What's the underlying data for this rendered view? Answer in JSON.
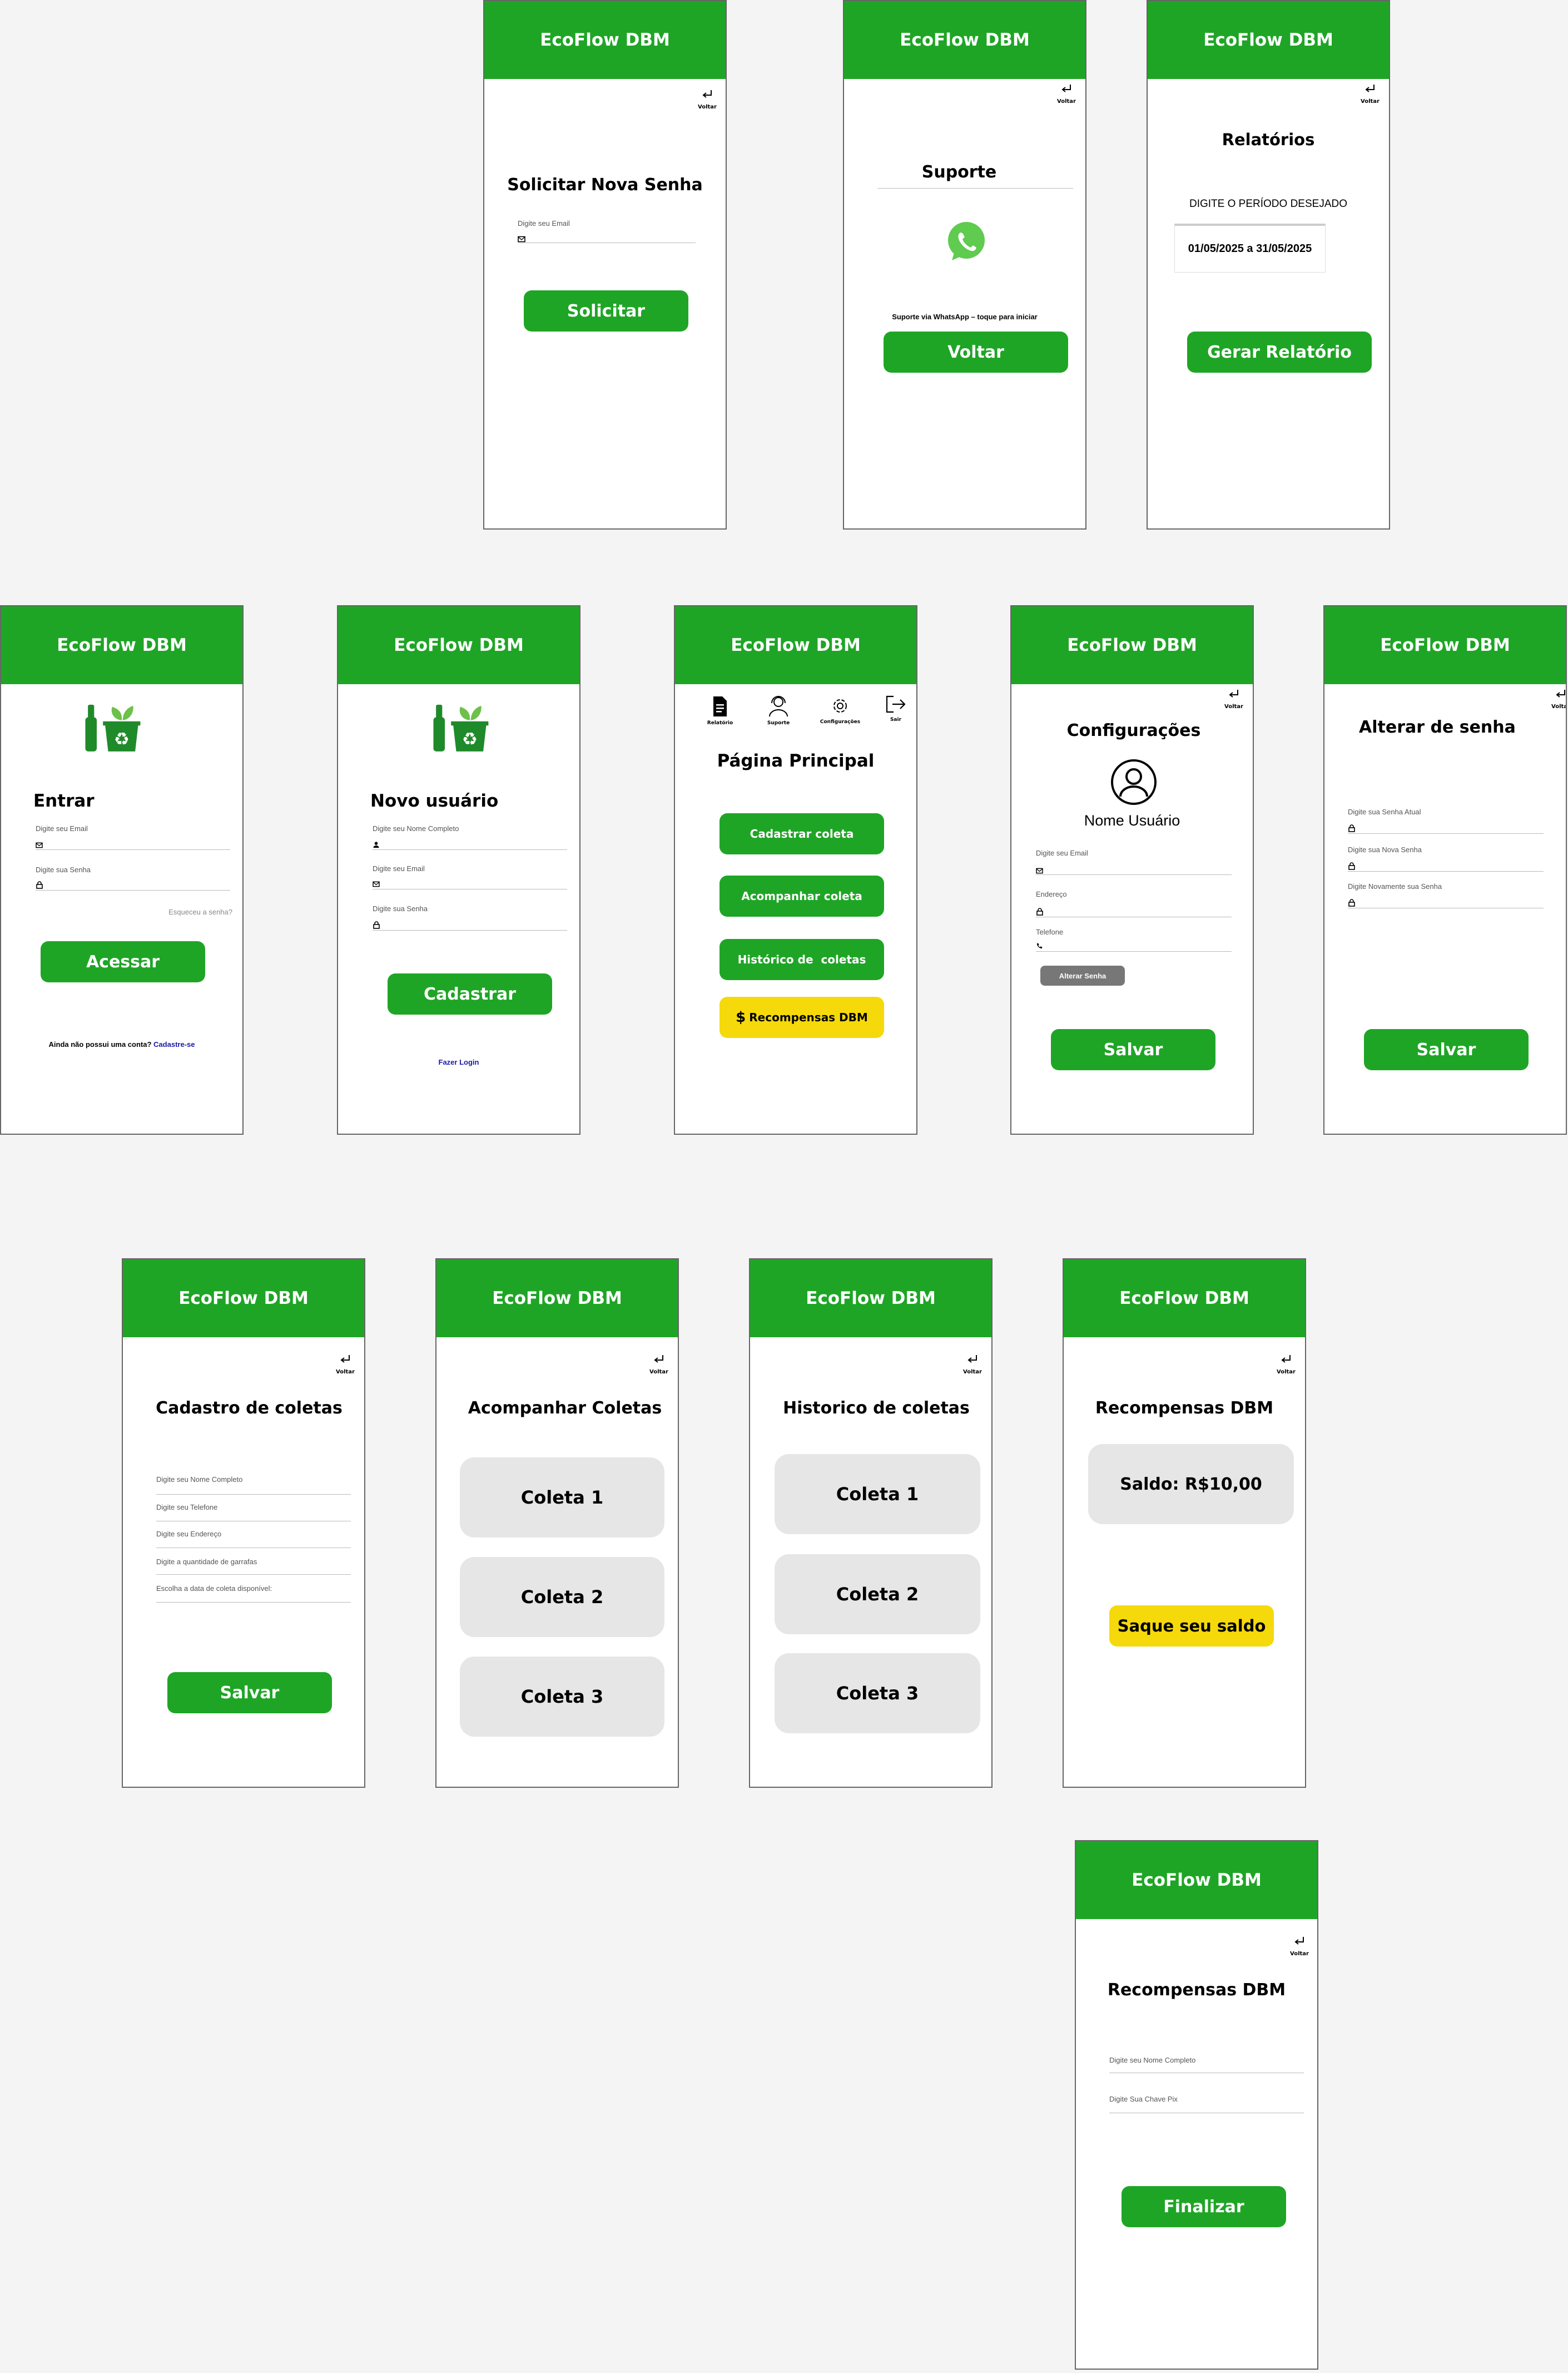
{
  "app_name": "EcoFlow DBM",
  "voltar": "Voltar",
  "colors": {
    "brand_green": "#1fa526",
    "accent_yellow": "#f5d90b",
    "gray_button": "#777777",
    "link_blue": "#1a1aa8"
  },
  "solicitar": {
    "title": "Solicitar Nova Senha",
    "email_label": "Digite seu Email",
    "button": "Solicitar"
  },
  "suporte": {
    "title": "Suporte",
    "caption": "Suporte via WhatsApp – toque para iniciar",
    "button": "Voltar",
    "icon": "whatsapp-icon"
  },
  "relatorios": {
    "title": "Relatórios",
    "prompt": "DIGITE O PERÍODO DESEJADO",
    "period": "01/05/2025 a 31/05/2025",
    "button": "Gerar Relatório"
  },
  "login": {
    "title": "Entrar",
    "email_label": "Digite seu Email",
    "password_label": "Digite sua Senha",
    "forgot": "Esqueceu a senha?",
    "button": "Acessar",
    "no_account": "Ainda não possui uma conta?",
    "signup_link": "Cadastre-se"
  },
  "novo": {
    "title": "Novo usuário",
    "name_label": "Digite seu Nome Completo",
    "email_label": "Digite seu Email",
    "password_label": "Digite sua Senha",
    "button": "Cadastrar",
    "login_link": "Fazer Login"
  },
  "principal": {
    "nav": [
      "Relatório",
      "Suporte",
      "Configurações",
      "Sair"
    ],
    "title": "Página Principal",
    "b1": "Cadastrar coleta",
    "b2": "Acompanhar coleta",
    "b3": "Histórico de  coletas",
    "b4_symbol": "$",
    "b4": "Recompensas DBM"
  },
  "config": {
    "title": "Configurações",
    "user_name": "Nome Usuário",
    "email_label": "Digite seu Email",
    "address_label": "Endereço",
    "phone_label": "Telefone",
    "alter_button": "Alterar Senha",
    "button": "Salvar"
  },
  "alterar": {
    "title": "Alterar de senha",
    "current_label": "Digite sua Senha Atual",
    "new_label": "Digite sua Nova Senha",
    "repeat_label": "Digite Novamente sua Senha",
    "button": "Salvar"
  },
  "cadastro": {
    "title": "Cadastro de coletas",
    "fields": [
      "Digite seu Nome Completo",
      "Digite seu Telefone",
      "Digite seu Endereço",
      "Digite a quantidade de garrafas",
      "Escolha a data de coleta disponível:"
    ],
    "button": "Salvar"
  },
  "acompanhar": {
    "title": "Acompanhar Coletas",
    "items": [
      "Coleta 1",
      "Coleta 2",
      "Coleta 3"
    ]
  },
  "historico": {
    "title": "Historico de coletas",
    "items": [
      "Coleta 1",
      "Coleta 2",
      "Coleta 3"
    ]
  },
  "recompensas": {
    "title": "Recompensas DBM",
    "balance": "Saldo: R$10,00",
    "button": "Saque seu saldo"
  },
  "saque": {
    "title": "Recompensas DBM",
    "name_label": "Digite seu Nome Completo",
    "pix_label": "Digite Sua Chave Pix",
    "button": "Finalizar"
  }
}
